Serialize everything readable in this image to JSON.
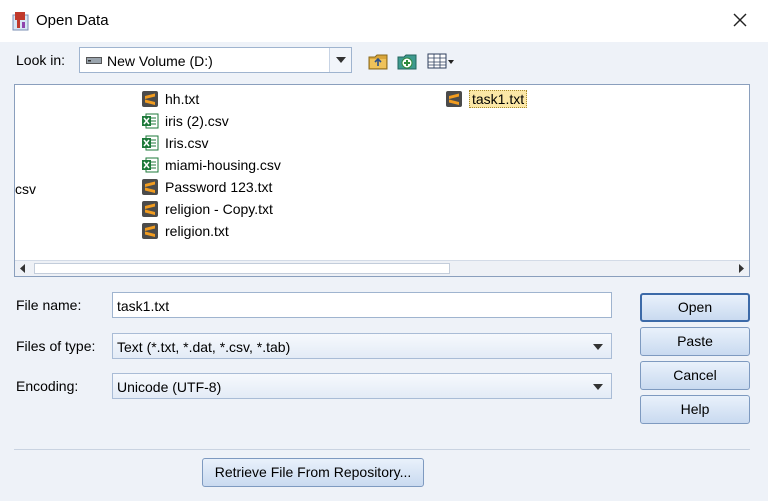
{
  "window": {
    "title": "Open Data"
  },
  "lookin": {
    "label": "Look in:",
    "value": "New Volume (D:)"
  },
  "files": [
    {
      "name": "hh.txt",
      "icon": "sublime-text-file-icon",
      "selected": false
    },
    {
      "name": "iris (2).csv",
      "icon": "excel-file-icon",
      "selected": false
    },
    {
      "name": "Iris.csv",
      "icon": "excel-file-icon",
      "selected": false
    },
    {
      "name": "miami-housing.csv",
      "icon": "excel-file-icon",
      "selected": false
    },
    {
      "name": "Password 123.txt",
      "icon": "sublime-text-file-icon",
      "selected": false
    },
    {
      "name": "religion - Copy.txt",
      "icon": "sublime-text-file-icon",
      "selected": false
    },
    {
      "name": "religion.txt",
      "icon": "sublime-text-file-icon",
      "selected": false
    },
    {
      "name": "task1.txt",
      "icon": "sublime-text-file-icon",
      "selected": true
    }
  ],
  "partial_column_text": "csv",
  "form": {
    "filename_label": "File name:",
    "filename_value": "task1.txt",
    "filetype_label": "Files of type:",
    "filetype_value": "Text (*.txt, *.dat, *.csv, *.tab)",
    "encoding_label": "Encoding:",
    "encoding_value": "Unicode (UTF-8)"
  },
  "buttons": {
    "open": "Open",
    "paste": "Paste",
    "cancel": "Cancel",
    "help": "Help",
    "retrieve": "Retrieve File From Repository..."
  },
  "colors": {
    "selection": "#fbe7a6",
    "sublime_icon": "#4b4b4b",
    "sublime_accent": "#f29c1f",
    "excel_green": "#1d7a3a"
  }
}
